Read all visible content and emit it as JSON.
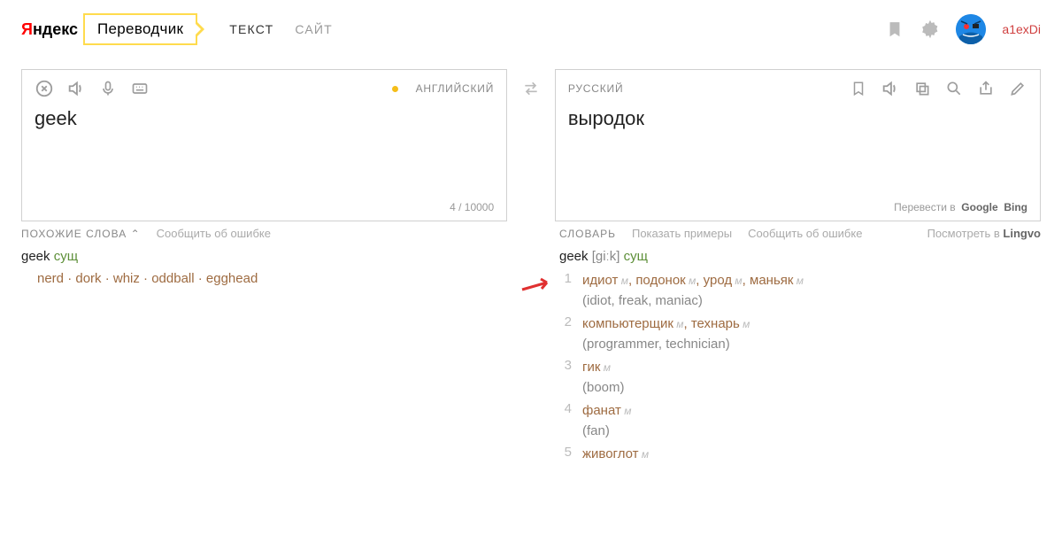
{
  "header": {
    "logo_y": "Я",
    "logo_rest": "ндекс",
    "badge": "Переводчик",
    "nav_text": "ТЕКСТ",
    "nav_site": "САЙТ",
    "username": "a1exDi"
  },
  "source": {
    "lang": "АНГЛИЙСКИЙ",
    "text": "geek",
    "counter": "4 / 10000"
  },
  "target": {
    "lang": "РУССКИЙ",
    "text": "выродок",
    "footer_prefix": "Перевести в",
    "footer_google": "Google",
    "footer_bing": "Bing"
  },
  "similar": {
    "title": "ПОХОЖИЕ СЛОВА",
    "report": "Сообщить об ошибке",
    "word": "geek",
    "pos": "сущ",
    "synonyms": "nerd · dork · whiz · oddball · egghead"
  },
  "dict": {
    "title": "СЛОВАРЬ",
    "examples": "Показать примеры",
    "report": "Сообщить об ошибке",
    "view_in": "Посмотреть в",
    "lingvo": "Lingvo",
    "word": "geek",
    "ipa": "[giːk]",
    "pos": "сущ",
    "items": [
      {
        "num": "1",
        "words": [
          [
            "идиот",
            "м"
          ],
          [
            "подонок",
            "м"
          ],
          [
            "урод",
            "м"
          ],
          [
            "маньяк",
            "м"
          ]
        ],
        "gloss": "(idiot, freak, maniac)"
      },
      {
        "num": "2",
        "words": [
          [
            "компьютерщик",
            "м"
          ],
          [
            "технарь",
            "м"
          ]
        ],
        "gloss": "(programmer, technician)"
      },
      {
        "num": "3",
        "words": [
          [
            "гик",
            "м"
          ]
        ],
        "gloss": "(boom)"
      },
      {
        "num": "4",
        "words": [
          [
            "фанат",
            "м"
          ]
        ],
        "gloss": "(fan)"
      },
      {
        "num": "5",
        "words": [
          [
            "живоглот",
            "м"
          ]
        ],
        "gloss": ""
      }
    ]
  }
}
